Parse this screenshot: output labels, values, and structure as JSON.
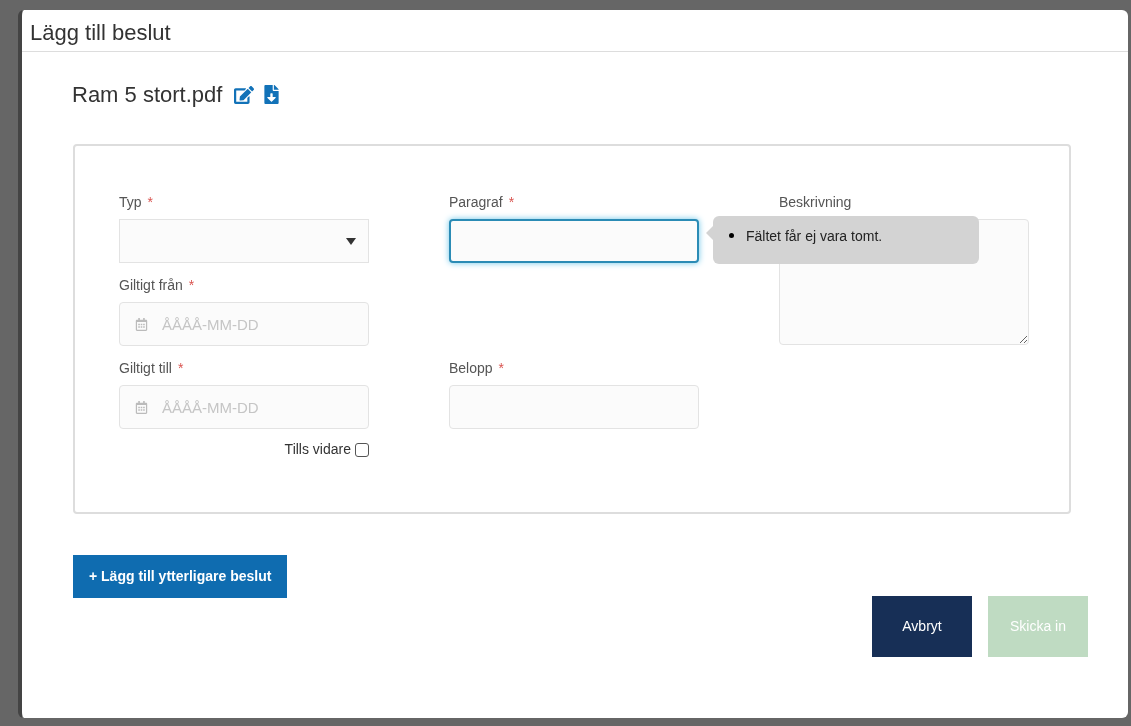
{
  "dialog": {
    "title": "Lägg till beslut",
    "file_name": "Ram 5 stort.pdf"
  },
  "required_mark": "*",
  "fields": [
    {
      "kind": "select",
      "label": "Typ",
      "required": true,
      "focused": false
    },
    {
      "kind": "text",
      "label": "Paragraf",
      "required": true,
      "focused": true,
      "error": "Fältet får ej vara tomt."
    },
    {
      "kind": "textarea",
      "label": "Beskrivning",
      "required": false,
      "focused": false
    },
    {
      "kind": "date",
      "label": "Giltigt från",
      "required": true,
      "focused": false,
      "placeholder": "ÅÅÅÅ-MM-DD"
    },
    {
      "kind": "date",
      "label": "Giltigt till",
      "required": true,
      "focused": false,
      "placeholder": "ÅÅÅÅ-MM-DD"
    },
    {
      "kind": "text",
      "label": "Belopp",
      "required": true,
      "focused": false
    }
  ],
  "checkbox": {
    "label": "Tills vidare",
    "checked": false
  },
  "add_button": "+ Lägg till ytterligare beslut",
  "buttons": [
    {
      "kind": "cancel",
      "label": "Avbryt",
      "disabled": false
    },
    {
      "kind": "submit",
      "label": "Skicka in",
      "disabled": true
    }
  ]
}
